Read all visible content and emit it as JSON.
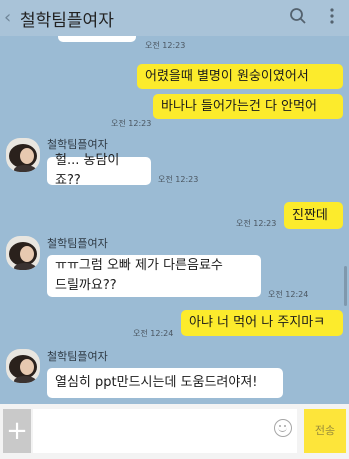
{
  "header": {
    "back_icon": "chevron-left-icon",
    "title": "철학팀플여자",
    "search_icon": "search-icon",
    "menu_icon": "more-vertical-icon"
  },
  "messages": {
    "m0_time": "오전 12:23",
    "m1_text": "어렸을때 별명이 원숭이였어서",
    "m2_text": "바나나 들어가는건 다 안먹어",
    "m2_time": "오전 12:23",
    "m3_name": "철학팀플여자",
    "m3_text": "헐... 농담이죠??",
    "m3_time": "오전 12:23",
    "m4_text": "진짠데",
    "m4_time": "오전 12:23",
    "m5_name": "철학팀플여자",
    "m5_line1": "ㅠㅠ그럼 오빠 제가 다른음료수",
    "m5_line2": "드릴까요??",
    "m5_time": "오전 12:24",
    "m6_text": "아냐 너 먹어 나 주지마ㅋ",
    "m6_time": "오전 12:24",
    "m7_name": "철학팀플여자",
    "m7_text": "열심히 ppt만드시는데 도움드려야져!"
  },
  "footer": {
    "plus_label": "+",
    "send_label": "전송",
    "emoji_icon": "emoji-icon"
  },
  "colors": {
    "background": "#9bbbd4",
    "my_bubble": "#fceb2c",
    "their_bubble": "#ffffff",
    "send_button": "#fde53a"
  }
}
